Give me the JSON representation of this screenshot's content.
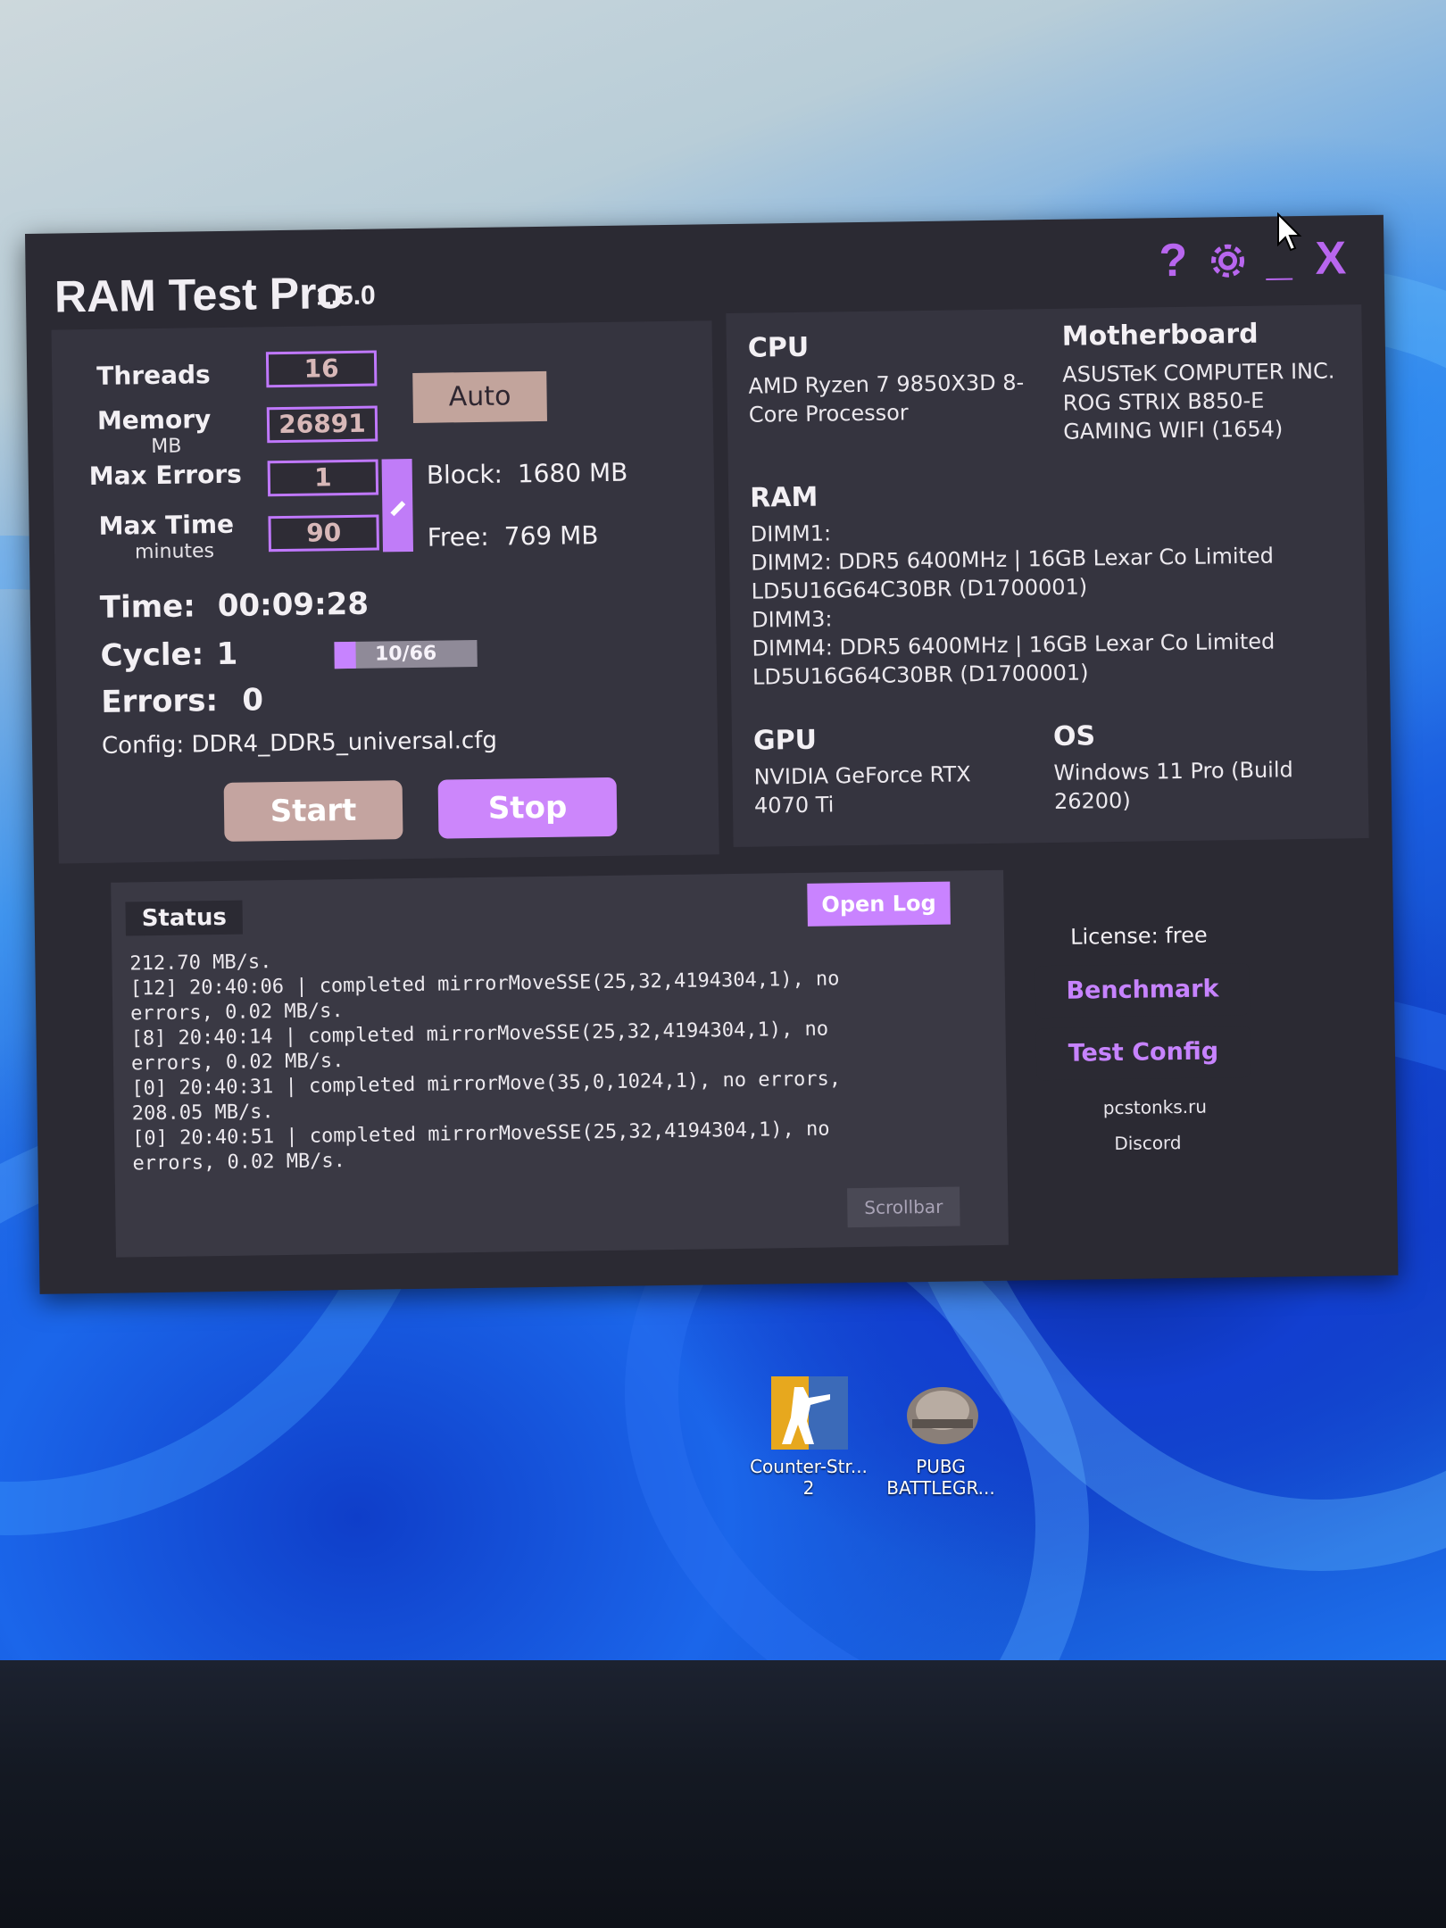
{
  "app": {
    "title": "RAM Test Pro",
    "version": "1.5.0"
  },
  "titlebar": {
    "help_label": "?",
    "minimize_label": "_",
    "close_label": "X"
  },
  "settings": {
    "threads_label": "Threads",
    "threads_value": "16",
    "memory_label": "Memory",
    "memory_unit": "MB",
    "memory_value": "26891",
    "max_errors_label": "Max Errors",
    "max_errors_value": "1",
    "max_time_label": "Max Time",
    "max_time_unit": "minutes",
    "max_time_value": "90",
    "auto_label": "Auto",
    "block_label": "Block:",
    "block_value": "1680 MB",
    "free_label": "Free:",
    "free_value": "769 MB"
  },
  "run": {
    "time_label": "Time:",
    "time_value": "00:09:28",
    "cycle_label": "Cycle:",
    "cycle_value": "1",
    "progress_text": "10/66",
    "progress_fraction": 0.15,
    "errors_label": "Errors:",
    "errors_value": "0",
    "config_text": "Config: DDR4_DDR5_universal.cfg",
    "start_label": "Start",
    "stop_label": "Stop"
  },
  "system": {
    "cpu_heading": "CPU",
    "cpu_line1": "AMD Ryzen 7 9850X3D 8-",
    "cpu_line2": "Core Processor",
    "mb_heading": "Motherboard",
    "mb_line1": "ASUSTeK COMPUTER INC.",
    "mb_line2": "ROG STRIX B850-E",
    "mb_line3": "GAMING WIFI (1654)",
    "ram_heading": "RAM",
    "ram_lines": [
      "DIMM1:",
      "DIMM2: DDR5 6400MHz | 16GB Lexar Co Limited",
      "LD5U16G64C30BR (D1700001)",
      "DIMM3:",
      "DIMM4: DDR5 6400MHz | 16GB Lexar Co Limited",
      "LD5U16G64C30BR (D1700001)"
    ],
    "gpu_heading": "GPU",
    "gpu_line1": "NVIDIA GeForce RTX",
    "gpu_line2": "4070 Ti",
    "os_heading": "OS",
    "os_line1": "Windows 11 Pro (Build",
    "os_line2": "26200)"
  },
  "status": {
    "tab_label": "Status",
    "open_log_label": "Open Log",
    "scrollbar_label": "Scrollbar",
    "log_lines": [
      "212.70 MB/s.",
      "[12] 20:40:06 | completed mirrorMoveSSE(25,32,4194304,1), no",
      "errors, 0.02 MB/s.",
      "[8] 20:40:14 | completed mirrorMoveSSE(25,32,4194304,1), no",
      "errors, 0.02 MB/s.",
      "[0] 20:40:31 | completed mirrorMove(35,0,1024,1), no errors,",
      "208.05 MB/s.",
      "[0] 20:40:51 | completed mirrorMoveSSE(25,32,4194304,1), no",
      "errors, 0.02 MB/s."
    ]
  },
  "sidebar": {
    "license_text": "License: free",
    "benchmark_label": "Benchmark",
    "test_config_label": "Test Config",
    "site_link": "pcstonks.ru",
    "discord_link": "Discord"
  },
  "desktop": {
    "icon1_line1": "Counter-Str...",
    "icon1_line2": "2",
    "icon2_line1": "PUBG",
    "icon2_line2": "BATTLEGR..."
  },
  "colors": {
    "accent": "#c783ff",
    "window_bg": "#2b2a33",
    "panel_bg": "#35343f",
    "start_btn": "#c4a4a0"
  }
}
